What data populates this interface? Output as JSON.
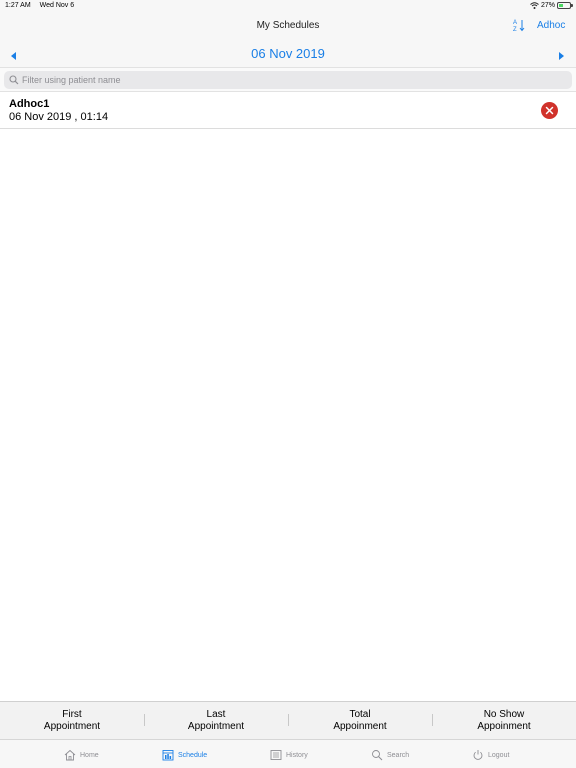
{
  "status_bar": {
    "time": "1:27 AM",
    "date": "Wed Nov 6",
    "battery": "27%",
    "battery_level": 0.27
  },
  "nav": {
    "title": "My Schedules",
    "sort_label_a": "A",
    "sort_label_z": "Z",
    "adhoc_label": "Adhoc"
  },
  "date_bar": {
    "date": "06 Nov 2019"
  },
  "search": {
    "placeholder": "Filter using patient name",
    "value": ""
  },
  "appointments": [
    {
      "name": "Adhoc1",
      "datetime": "06 Nov 2019 , 01:14"
    }
  ],
  "summary": {
    "first": {
      "line1": "First",
      "line2": "Appointment"
    },
    "last": {
      "line1": "Last",
      "line2": "Appointment"
    },
    "total": {
      "line1": "Total",
      "line2": "Appoinment"
    },
    "noshow": {
      "line1": "No Show",
      "line2": "Appoinment"
    }
  },
  "tabs": [
    {
      "label": "Home",
      "icon": "home-icon",
      "active": false
    },
    {
      "label": "Schedule",
      "icon": "calendar-icon",
      "active": true
    },
    {
      "label": "History",
      "icon": "history-icon",
      "active": false
    },
    {
      "label": "Search",
      "icon": "search-icon",
      "active": false
    },
    {
      "label": "Logout",
      "icon": "power-icon",
      "active": false
    }
  ],
  "colors": {
    "accent": "#1a7fe6",
    "remove": "#d0322b",
    "battery_fill": "#4cd964",
    "inactive": "#8e8e93"
  }
}
